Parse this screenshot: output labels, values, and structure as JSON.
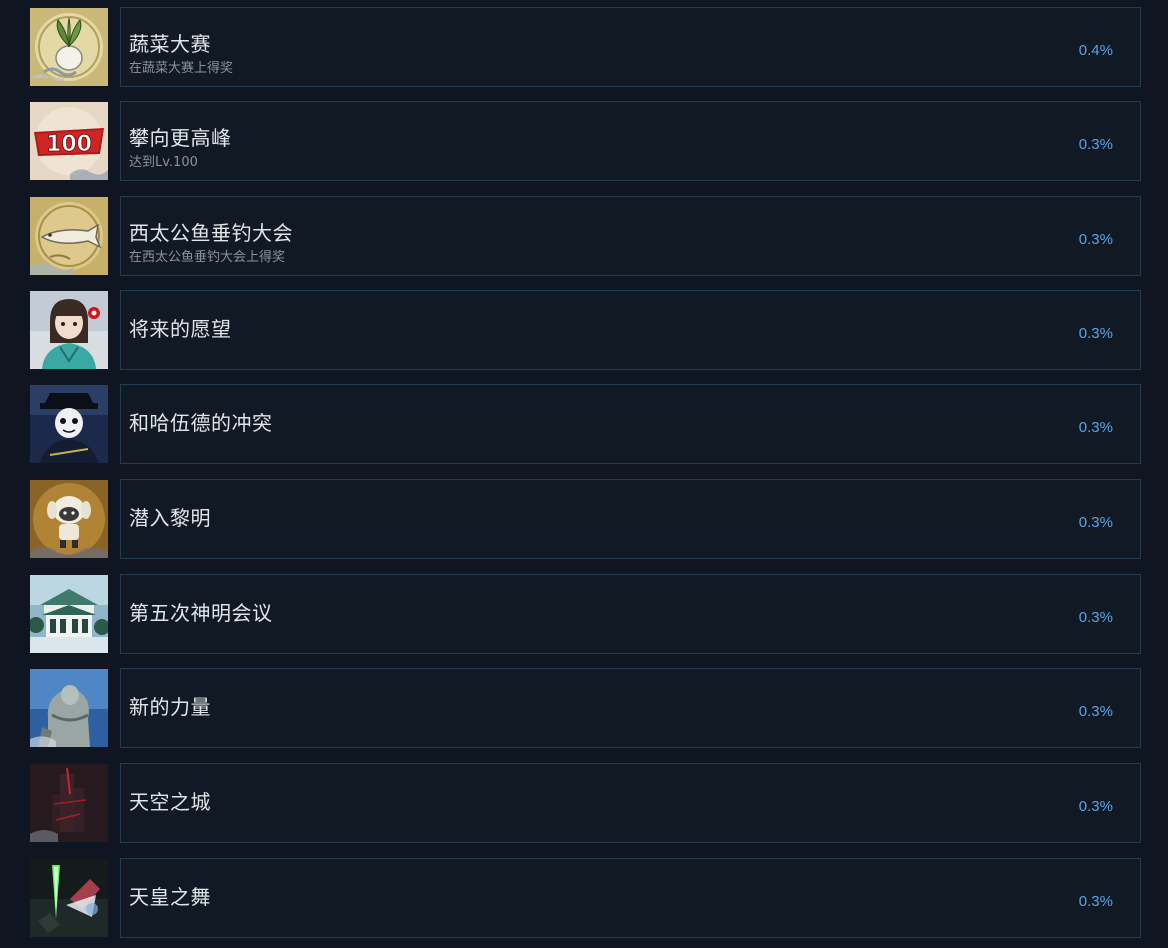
{
  "achievements": [
    {
      "title": "蔬菜大赛",
      "desc": "在蔬菜大赛上得奖",
      "percent": "0.4%",
      "icon": "vegetable-trophy-icon"
    },
    {
      "title": "攀向更高峰",
      "desc": "达到Lv.100",
      "percent": "0.3%",
      "icon": "level-100-icon",
      "icon_text": "100"
    },
    {
      "title": "西太公鱼垂钓大会",
      "desc": "在西太公鱼垂钓大会上得奖",
      "percent": "0.3%",
      "icon": "fish-trophy-icon"
    },
    {
      "title": "将来的愿望",
      "desc": "",
      "percent": "0.3%",
      "icon": "girl-portrait-icon"
    },
    {
      "title": "和哈伍德的冲突",
      "desc": "",
      "percent": "0.3%",
      "icon": "masked-figure-icon"
    },
    {
      "title": "潜入黎明",
      "desc": "",
      "percent": "0.3%",
      "icon": "creature-icon"
    },
    {
      "title": "第五次神明会议",
      "desc": "",
      "percent": "0.3%",
      "icon": "shrine-building-icon"
    },
    {
      "title": "新的力量",
      "desc": "",
      "percent": "0.3%",
      "icon": "statue-icon"
    },
    {
      "title": "天空之城",
      "desc": "",
      "percent": "0.3%",
      "icon": "sky-castle-icon"
    },
    {
      "title": "天皇之舞",
      "desc": "",
      "percent": "0.3%",
      "icon": "glowing-sword-icon"
    }
  ],
  "colors": {
    "background": "#0f1622",
    "card_border": "#263b4f",
    "percent": "#57a6e8",
    "title": "#e2e6ea",
    "desc": "#8a939c"
  }
}
